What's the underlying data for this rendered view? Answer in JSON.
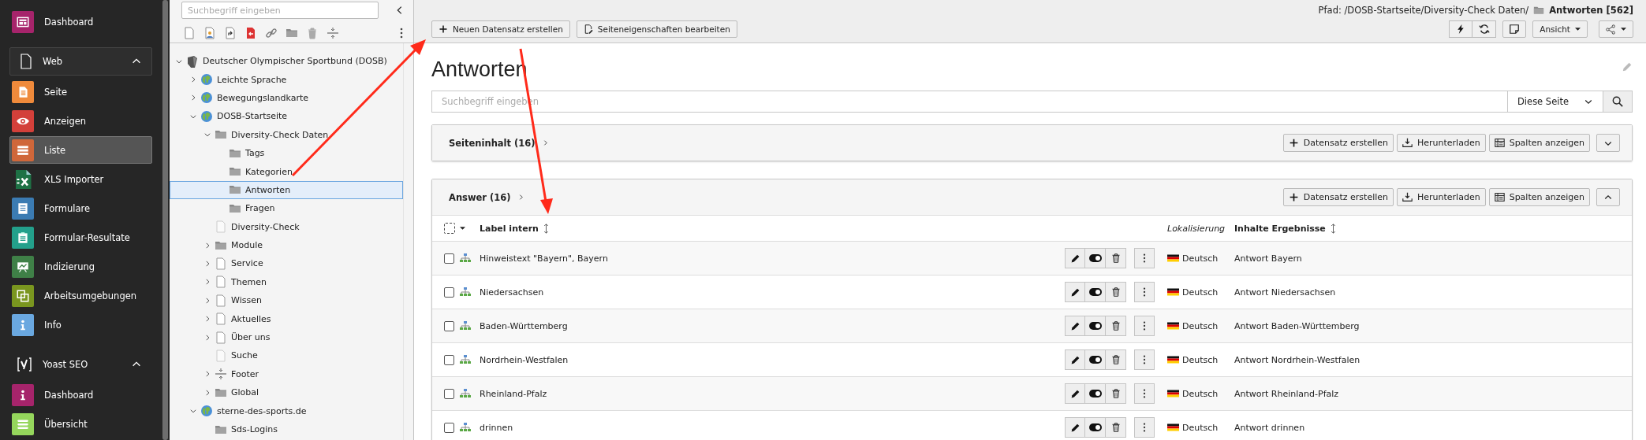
{
  "module_menu": [
    {
      "kind": "item",
      "label": "Dashboard",
      "color": "#a6246b",
      "selected": false
    },
    {
      "kind": "group",
      "label": "Web",
      "active": true,
      "expanded": true,
      "items": [
        {
          "label": "Seite",
          "color": "#ef8a3b",
          "selected": false
        },
        {
          "label": "Anzeigen",
          "color": "#d3403a",
          "selected": false
        },
        {
          "label": "Liste",
          "color": "#d0673a",
          "selected": true
        },
        {
          "label": "XLS Importer",
          "color": "#1e7145",
          "selected": false
        },
        {
          "label": "Formulare",
          "color": "#3b7bb2",
          "selected": false
        },
        {
          "label": "Formular-Resultate",
          "color": "#23a08b",
          "selected": false
        },
        {
          "label": "Indizierung",
          "color": "#3f8047",
          "selected": false
        },
        {
          "label": "Arbeitsumgebungen",
          "color": "#7a961f",
          "selected": false
        },
        {
          "label": "Info",
          "color": "#6aa8e0",
          "selected": false
        }
      ]
    },
    {
      "kind": "group",
      "label": "Yoast SEO",
      "active": false,
      "expanded": true,
      "items": [
        {
          "label": "Dashboard",
          "color": "#a6246b",
          "selected": false
        },
        {
          "label": "Übersicht",
          "color": "#95d65c",
          "selected": false
        }
      ]
    }
  ],
  "page_tree": {
    "search": {
      "placeholder": "Suchbegriff eingeben"
    },
    "nodes": [
      {
        "label": "Deutscher Olympischer Sportbund (DOSB)",
        "kind": "site-root",
        "expanded": true,
        "selected": false,
        "children": [
          {
            "label": "Leichte Sprache",
            "kind": "globe",
            "expanded": false,
            "selected": false
          },
          {
            "label": "Bewegungslandkarte",
            "kind": "globe",
            "expanded": false,
            "selected": false
          },
          {
            "label": "DOSB-Startseite",
            "kind": "globe",
            "expanded": true,
            "selected": false,
            "children": [
              {
                "label": "Diversity-Check Daten",
                "kind": "folder",
                "expanded": true,
                "selected": false,
                "children": [
                  {
                    "label": "Tags",
                    "kind": "folder",
                    "selected": false
                  },
                  {
                    "label": "Kategorien",
                    "kind": "folder",
                    "selected": false
                  },
                  {
                    "label": "Antworten",
                    "kind": "folder",
                    "selected": true
                  },
                  {
                    "label": "Fragen",
                    "kind": "folder",
                    "selected": false
                  }
                ]
              },
              {
                "label": "Diversity-Check",
                "kind": "page-hidden",
                "selected": false
              },
              {
                "label": "Module",
                "kind": "folder",
                "expanded": false,
                "selected": false
              },
              {
                "label": "Service",
                "kind": "page",
                "expanded": false,
                "selected": false
              },
              {
                "label": "Themen",
                "kind": "page",
                "expanded": false,
                "selected": false
              },
              {
                "label": "Wissen",
                "kind": "page",
                "expanded": false,
                "selected": false
              },
              {
                "label": "Aktuelles",
                "kind": "page",
                "expanded": false,
                "selected": false
              },
              {
                "label": "Über uns",
                "kind": "page",
                "expanded": false,
                "selected": false
              },
              {
                "label": "Suche",
                "kind": "page-hidden",
                "selected": false
              },
              {
                "label": "Footer",
                "kind": "separator",
                "expanded": false,
                "selected": false
              },
              {
                "label": "Global",
                "kind": "folder",
                "expanded": false,
                "selected": false
              }
            ]
          },
          {
            "label": "sterne-des-sports.de",
            "kind": "globe",
            "expanded": true,
            "selected": false,
            "children": [
              {
                "label": "Sds-Logins",
                "kind": "folder",
                "selected": false
              }
            ]
          }
        ]
      }
    ]
  },
  "doc_header": {
    "path": "Pfad: /DOSB-Startseite/Diversity-Check Daten/",
    "current_page": "Antworten [562]",
    "buttons": [
      "Neuen Datensatz erstellen",
      "Seiteneigenschaften bearbeiten"
    ],
    "view_menu": "Ansicht"
  },
  "title": "Antworten",
  "search": {
    "placeholder": "Suchbegriff eingeben",
    "scope": "Diese Seite"
  },
  "tables": [
    {
      "title": "Seiteninhalt (16)",
      "expanded": false,
      "actions": [
        "Datensatz erstellen",
        "Herunterladen",
        "Spalten anzeigen"
      ]
    },
    {
      "title": "Answer (16)",
      "expanded": true,
      "actions": [
        "Datensatz erstellen",
        "Herunterladen",
        "Spalten anzeigen"
      ],
      "all_selected": false,
      "columns": [
        {
          "label": "Label intern",
          "kind": "sortable"
        },
        {
          "label": "Lokalisierung",
          "kind": "italic"
        },
        {
          "label": "Inhalte Ergebnisse",
          "kind": "sortable"
        }
      ],
      "rows": [
        {
          "label": "Hinweistext \"Bayern\", Bayern",
          "language": "Deutsch",
          "result": "Antwort Bayern",
          "checked": false
        },
        {
          "label": "Niedersachsen",
          "language": "Deutsch",
          "result": "Antwort Niedersachsen",
          "checked": false
        },
        {
          "label": "Baden-Württemberg",
          "language": "Deutsch",
          "result": "Antwort Baden-Württemberg",
          "checked": false
        },
        {
          "label": "Nordrhein-Westfalen",
          "language": "Deutsch",
          "result": "Antwort Nordrhein-Westfalen",
          "checked": false
        },
        {
          "label": "Rheinland-Pfalz",
          "language": "Deutsch",
          "result": "Antwort Rheinland-Pfalz",
          "checked": false
        },
        {
          "label": "drinnen",
          "language": "Deutsch",
          "result": "Antwort drinnen",
          "checked": false
        }
      ]
    }
  ]
}
